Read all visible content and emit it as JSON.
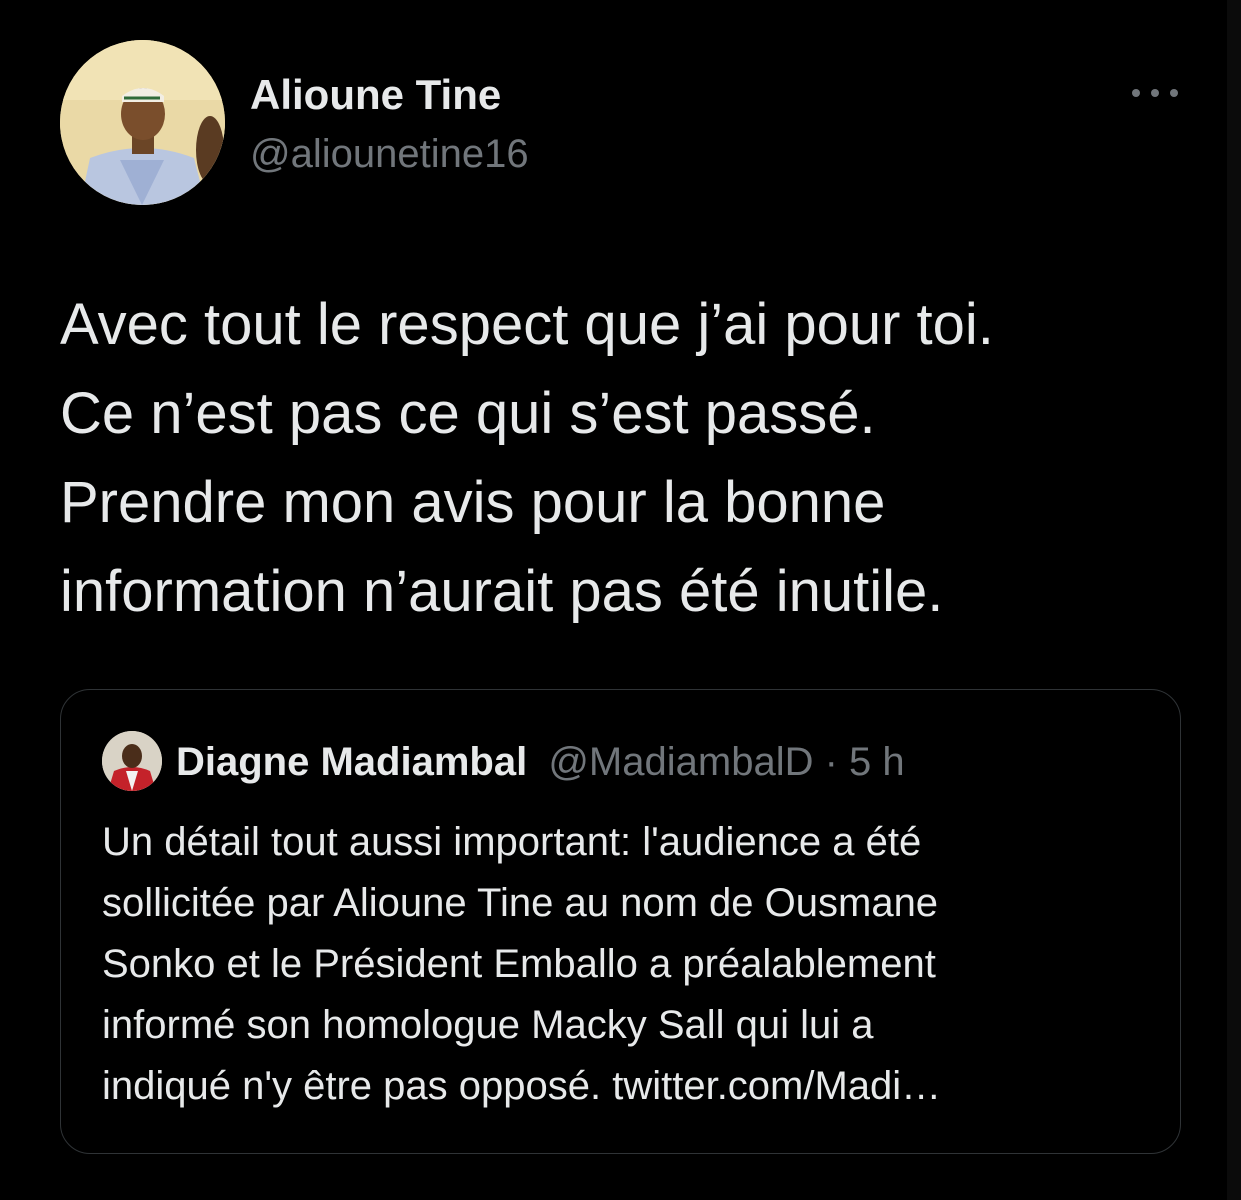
{
  "tweet": {
    "author": {
      "name": "Alioune Tine",
      "handle": "@aliounetine16"
    },
    "more_icon": "more-horizontal-icon",
    "text_lines": [
      "Avec tout le respect que j’ai pour toi.",
      "Ce n’est pas ce qui s’est passé.",
      "Prendre mon avis pour la bonne",
      "information n’aurait pas été inutile."
    ]
  },
  "quoted_tweet": {
    "author": {
      "name": "Diagne Madiambal",
      "handle": "@MadiambalD"
    },
    "separator": "·",
    "time": "5 h",
    "text_lines": [
      "Un détail tout aussi important: l'audience a été",
      "sollicitée par Alioune Tine au nom de Ousmane",
      "Sonko et le Président Emballo a préalablement",
      "informé son homologue Macky Sall qui lui a",
      "indiqué n'y être pas opposé. twitter.com/Madi…"
    ]
  },
  "colors": {
    "background": "#000000",
    "primary_text": "#e7e9ea",
    "secondary_text": "#71767b",
    "card_border": "#2f3336"
  }
}
